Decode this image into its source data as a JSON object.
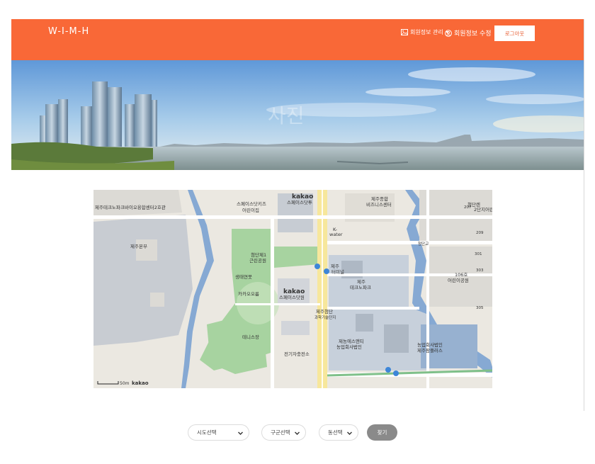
{
  "navbar": {
    "brand": "W-I-M-H",
    "manage_label": "회원정보 관리",
    "edit_label": "회원정보 수정",
    "logout_label": "로그아웃",
    "color": "#f96837"
  },
  "banner": {
    "overlay_text": "사진"
  },
  "map": {
    "labels": {
      "bio": "제주테크노파크바이오융합센터2호관",
      "kids": "스페이스닷키즈",
      "kids2": "어린이집",
      "kakao_top": "kakao",
      "space_top": "스페이스닷투",
      "bizcenter1": "제주종합",
      "bizcenter2": "비즈니스센터",
      "park_s1": "첨단렌",
      "park_s2": "2단지어린",
      "hq": "제주본부",
      "kwater1": "K-",
      "kwater2": "water",
      "cheomdan_park1": "첨단제1",
      "cheomdan_park2": "근린공원",
      "bridge": "첨단교",
      "eco": "생태연못",
      "terminal1": "제주",
      "terminal2": "터미널",
      "techno1": "제주",
      "techno2": "테크노파크",
      "park106_1": "106호",
      "park106_2": "어린이공원",
      "kakao_oreum": "카카오오름",
      "kakao_mid": "kakao",
      "space_one": "스페이스닷원",
      "cheomdan1": "제주첨단",
      "cheomdan2": "과학기술단지",
      "tennis": "테니스장",
      "charging": "전기자충전소",
      "jenong1": "제농에스앤티",
      "jenong2": "농업회사법인",
      "agri1": "농업회사법인",
      "agri2": "제주팜플러스",
      "scale": "50m",
      "kakao_logo": "kakao",
      "n207": "207",
      "n209": "209",
      "n301": "301",
      "n303": "303",
      "n305": "305"
    }
  },
  "search": {
    "sido_label": "시도선택",
    "gugun_label": "구군선택",
    "dong_label": "동선택",
    "find_label": "찾기"
  }
}
